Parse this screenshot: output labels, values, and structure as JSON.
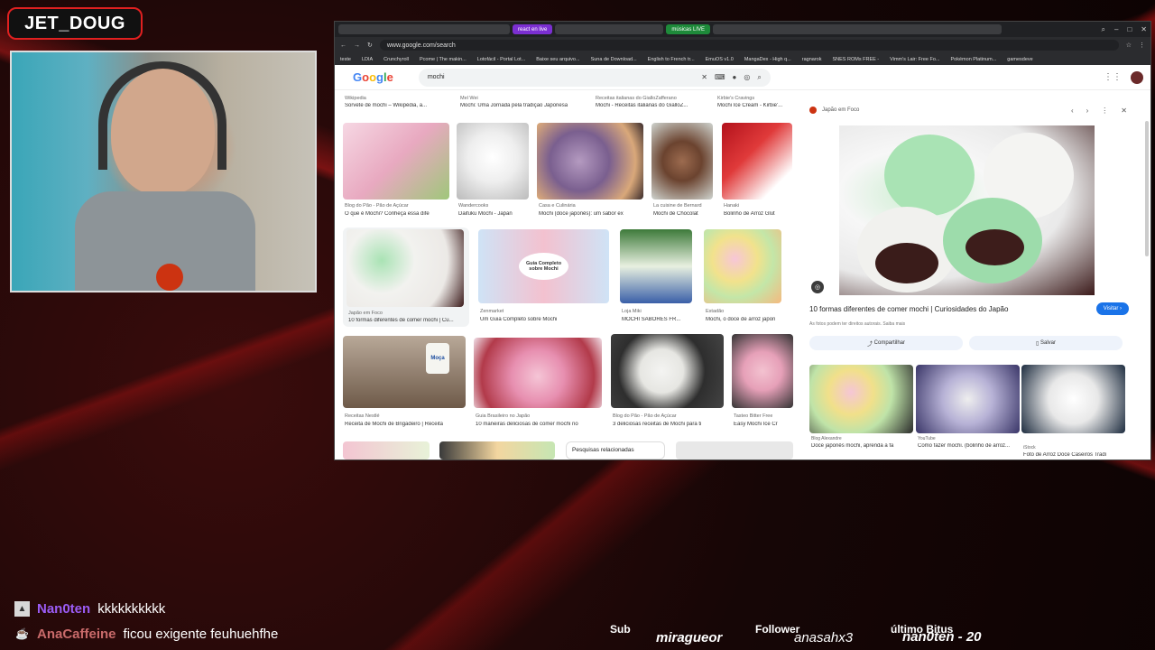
{
  "streamer": {
    "name": "JET_DOUG"
  },
  "browser": {
    "tabs": [
      {
        "label": "react en live",
        "color": "#7b2fd1"
      },
      {
        "label": "músicas LIVE",
        "color": "#1e8a3a"
      }
    ],
    "url": "www.google.com/search",
    "bookmarks": [
      "teste",
      "LDIA",
      "Crunchyroll",
      "Pcome | The makin...",
      "Lotofácil - Portal Lot...",
      "Baixe seu arquivo...",
      "Suna de Download...",
      "English to French tr...",
      "EmuOS v1.0",
      "MangaDex - High q...",
      "ragnarok",
      "SNES ROMs FREE -",
      "Vimm's Lair: Free Fo...",
      "Pokémon Platinum...",
      "gamesdeve"
    ]
  },
  "google": {
    "query": "mochi",
    "results": [
      {
        "src": "Wikipedia",
        "title": "Sorvete de mochi – Wikipédia, a..."
      },
      {
        "src": "Mel Wei",
        "title": "Mochi: Uma Jornada pela tradição Japonesa"
      },
      {
        "src": "Receitas italianas do GialloZafferano",
        "title": "Mochi - Receitas italianas do GialloZ..."
      },
      {
        "src": "Kirbie's Cravings",
        "title": "Mochi Ice Cream - Kirbie'..."
      },
      {
        "src": "Blog do Pão - Pão de Açúcar",
        "title": "O que é Mochi? Conheça essa dife"
      },
      {
        "src": "Wandercooks",
        "title": "Daifuku Mochi - Japan"
      },
      {
        "src": "Casa e Culinária",
        "title": "Mochi (doce japonês): um sabor ex"
      },
      {
        "src": "La cuisine de Bernard",
        "title": "Mochi de Chocolat"
      },
      {
        "src": "Hanaki",
        "title": "Bolinho de Arroz Glut"
      },
      {
        "src": "Japão em Foco",
        "title": "10 formas diferentes de comer mochi | Cu..."
      },
      {
        "src": "Zenmarket",
        "title": "Um Guia Completo sobre Mochi"
      },
      {
        "src": "Loja Miki",
        "title": "MOCHI SABORES FR..."
      },
      {
        "src": "Estadão",
        "title": "Mochi, o doce de arroz japon"
      },
      {
        "src": "Receitas Nestlé",
        "title": "Receita de Mochi de Brigadeiro | Receita"
      },
      {
        "src": "Guia Brasileiro no Japão",
        "title": "10 maneiras deliciosas de comer mochi no"
      },
      {
        "src": "Blog do Pão - Pão de Açúcar",
        "title": "3 deliciosas receitas de Mochi para ti"
      },
      {
        "src": "Tasteo Bitter Free",
        "title": "Easy Mochi Ice Cr"
      }
    ],
    "guide_label": "Guia Completo sobre Mochi",
    "can_label": "Moça",
    "related": "Pesquisas relacionadas",
    "panel": {
      "source": "Japão em Foco",
      "title": "10 formas diferentes de comer mochi | Curiosidades do Japão",
      "visit": "Visitar",
      "note": "As fotos podem ter direitos autorais. Saiba mais",
      "share": "Compartilhar",
      "save": "Salvar",
      "related": [
        {
          "src": "Blog Alexandre",
          "title": "Doce japonês mochi, aprenda a fa"
        },
        {
          "src": "YouTube",
          "title": "Como fazer mochi. (bolinho de arroz..."
        },
        {
          "src": "iStock",
          "title": "Foto de Arroz Doce Caseiros Tradi"
        }
      ]
    }
  },
  "chat": [
    {
      "user": "Nan0ten",
      "msg": "kkkkkkkkkk"
    },
    {
      "user": "AnaCaffeine",
      "msg": "ficou exigente feuhuehfhe"
    }
  ],
  "stats": {
    "sub_label": "Sub",
    "sub_value": "miragueor",
    "follower_label": "Follower",
    "follower_value": "anasahx3",
    "bits_label": "último Bitus",
    "bits_value": "nan0ten - 20"
  }
}
